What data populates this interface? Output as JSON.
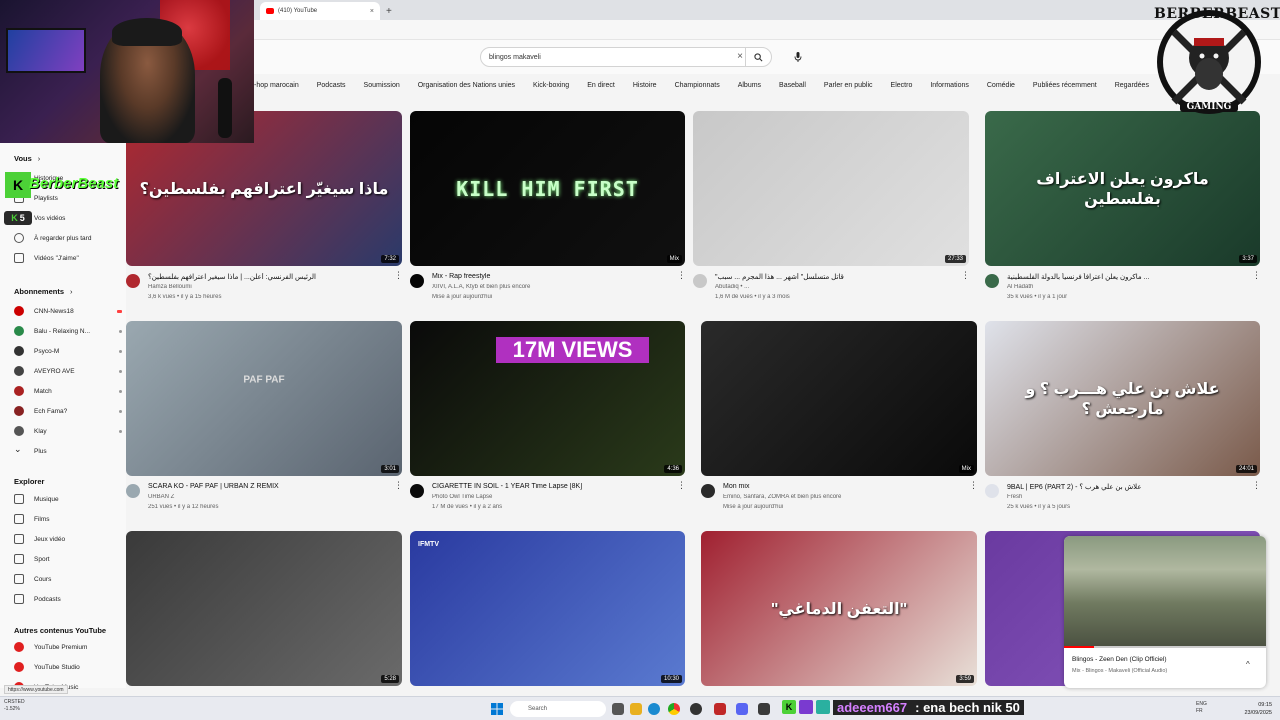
{
  "browser": {
    "tab_title": "(410) YouTube",
    "tab_close": "×",
    "new_tab": "+"
  },
  "header": {
    "search_value": "blingos makaveli",
    "clear": "×"
  },
  "chips": [
    "-hop marocain",
    "Podcasts",
    "Soumission",
    "Organisation des Nations unies",
    "Kick-boxing",
    "En direct",
    "Histoire",
    "Championnats",
    "Albums",
    "Baseball",
    "Parler en public",
    "Electro",
    "Informations",
    "Comédie",
    "Publiées récemment",
    "Regardées"
  ],
  "sidebar": {
    "vous_label": "Vous",
    "vous_chevron": "›",
    "vous_items": [
      {
        "label": "Historique",
        "icon": "history-icon"
      },
      {
        "label": "Playlists",
        "icon": "playlist-icon"
      },
      {
        "label": "Vos vidéos",
        "icon": "video-icon"
      },
      {
        "label": "À regarder plus tard",
        "icon": "clock-icon"
      },
      {
        "label": "Vidéos \"J'aime\"",
        "icon": "like-icon"
      }
    ],
    "subs_label": "Abonnements",
    "subs_chevron": "›",
    "subs_items": [
      {
        "label": "CNN-News18",
        "color": "#cc0000",
        "live": true
      },
      {
        "label": "Balu - Relaxing N...",
        "color": "#2a8a4a",
        "live": false
      },
      {
        "label": "Psyco-M",
        "color": "#333333",
        "live": false
      },
      {
        "label": "AVEYRO AVE",
        "color": "#444444",
        "live": false
      },
      {
        "label": "Match",
        "color": "#aa2222",
        "live": false
      },
      {
        "label": "Ech Fama?",
        "color": "#882222",
        "live": false
      },
      {
        "label": "Klay",
        "color": "#555555",
        "live": false
      },
      {
        "label": "Plus",
        "color": "",
        "live": false
      }
    ],
    "explore_label": "Explorer",
    "explore_items": [
      {
        "label": "Musique",
        "icon": "music-icon"
      },
      {
        "label": "Films",
        "icon": "film-icon"
      },
      {
        "label": "Jeux vidéo",
        "icon": "gamepad-icon"
      },
      {
        "label": "Sport",
        "icon": "trophy-icon"
      },
      {
        "label": "Cours",
        "icon": "bulb-icon"
      },
      {
        "label": "Podcasts",
        "icon": "podcast-icon"
      }
    ],
    "other_label": "Autres contenus YouTube",
    "other_items": [
      {
        "label": "YouTube Premium",
        "icon": "yt-premium-icon"
      },
      {
        "label": "YouTube Studio",
        "icon": "yt-studio-icon"
      },
      {
        "label": "YouTube Music",
        "icon": "yt-music-icon"
      }
    ]
  },
  "overlay": {
    "streamer_name": "BerberBeast",
    "k": "K",
    "k5_num": "5",
    "logo_top": "BERBERBEAST",
    "logo_bottom": "GAMING"
  },
  "videos": [
    {
      "title": "الرئيس الفرنسي: أعلن... | ماذا سيغير اعترافهم بفلسطين؟",
      "channel": "Hamza Belloumi",
      "meta": "3,6 k vues • il y a 15 heures",
      "duration": "7:32",
      "thumb_text": "ماذا سيغيّر اعترافهم بفلسطين؟",
      "colors": [
        "#b0282f",
        "#2a3a6a"
      ]
    },
    {
      "title": "Mix - Rap freestyle",
      "channel": "XIIVI, A.L.A, Ktyb et bien plus encore",
      "meta": "Mise à jour aujourd'hui",
      "duration": "Mix",
      "thumb_text": "KILL HIM FIRST",
      "colors": [
        "#050505",
        "#101010"
      ]
    },
    {
      "title": "\"قاتل متسلسل\" أشهر ... هذا المجرم ... سبب",
      "channel": "Abutadiq • ...",
      "meta": "1,6 M de vues • il y a 3 mois",
      "duration": "27:33",
      "thumb_text": "",
      "colors": [
        "#c8c8c8",
        "#e0e0e0"
      ]
    },
    {
      "title": "ماكرون يعلن اعترافاً فرنسياً بالدولة الفلسطينية ...",
      "channel": "Al Hadath",
      "meta": "35 k vues • il y a 1 jour",
      "duration": "3:37",
      "thumb_text": "ماكرون يعلن الاعتراف بفلسطين",
      "colors": [
        "#3a6a4a",
        "#1a3a2a"
      ]
    },
    {
      "title": "SCARA KO - PAF PAF | URBAN Z REMIX",
      "channel": "URBAN Z",
      "meta": "251 vues • il y a 12 heures",
      "duration": "3:01",
      "thumb_text": "PAF PAF",
      "colors": [
        "#9aa8b0",
        "#5a6470"
      ]
    },
    {
      "title": "CIGARETTE IN SOIL - 1 YEAR Time Lapse [8K]",
      "channel": "Photo Owl Time Lapse",
      "meta": "17 M de vues • il y a 2 ans",
      "duration": "4:36",
      "thumb_text": "17M VIEWS",
      "colors": [
        "#0a0a0a",
        "#2a3a1a"
      ]
    },
    {
      "title": "Mon mix",
      "channel": "Emino, Sanfara, ZOMRA et bien plus encore",
      "meta": "Mise à jour aujourd'hui",
      "duration": "Mix",
      "thumb_text": "",
      "colors": [
        "#2a2a2a",
        "#0a0a0a"
      ]
    },
    {
      "title": "9BAL | EP6 (PART 2) - علاش بن علي هرب ؟",
      "channel": "Fresh",
      "meta": "25 k vues • il y a 5 jours",
      "duration": "24:01",
      "thumb_text": "علاش بن علي هـــرب ؟ و مارجعش ؟",
      "colors": [
        "#dfe2ea",
        "#7a5a4a"
      ]
    },
    {
      "title": "",
      "channel": "",
      "meta": "",
      "duration": "5:28",
      "thumb_text": "",
      "colors": [
        "#3a3a3a",
        "#6a6a6a"
      ]
    },
    {
      "title": "",
      "channel": "",
      "meta": "",
      "duration": "10:30",
      "thumb_text": "IFMTV",
      "colors": [
        "#2a3aa0",
        "#5a7ad0"
      ]
    },
    {
      "title": "",
      "channel": "",
      "meta": "",
      "duration": "3:59",
      "thumb_text": "\"التعفن الدماغي\"",
      "colors": [
        "#a02030",
        "#e8e0d8"
      ]
    },
    {
      "title": "",
      "channel": "",
      "meta": "",
      "duration": "",
      "thumb_text": "",
      "colors": [
        "#6a3aa0",
        "#8a5ac0"
      ]
    }
  ],
  "miniplayer": {
    "title": "Blingos - Zeen Den (Clip Officiel)",
    "subtitle": "Mix - Blingos - Makaveli (Official Audio)",
    "progress": 0.15,
    "chevron": "^"
  },
  "taskbar": {
    "search_placeholder": "Search",
    "weather_line1": "CRSTED",
    "weather_line2": "-1.52%",
    "lang1": "ENG",
    "lang2": "FR",
    "time": "09:15",
    "date": "23/09/2025",
    "url_tooltip": "https://www.youtube.com"
  },
  "chat": {
    "user": "adeeem667",
    "message": ": ena bech nik 50"
  }
}
